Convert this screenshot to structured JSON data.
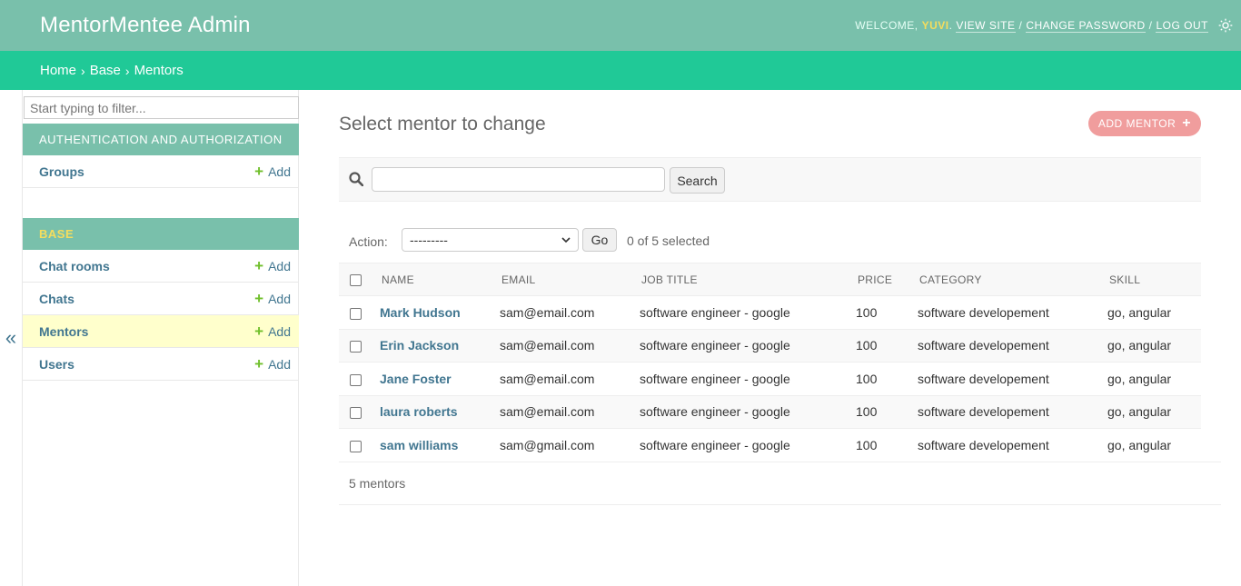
{
  "header": {
    "branding": "MentorMentee Admin",
    "welcome": "WELCOME,",
    "username": "YUVI",
    "view_site": "VIEW SITE",
    "change_password": "CHANGE PASSWORD",
    "log_out": "LOG OUT",
    "separator": "/",
    "theme_icon": "sun-icon"
  },
  "breadcrumbs": {
    "items": [
      "Home",
      "Base",
      "Mentors"
    ],
    "separator": "›"
  },
  "sidebar": {
    "collapse_glyph": "«",
    "filter_placeholder": "Start typing to filter...",
    "add_label": "Add",
    "modules": [
      {
        "caption": "AUTHENTICATION AND AUTHORIZATION",
        "models": [
          {
            "name": "Groups",
            "current": false
          }
        ]
      },
      {
        "caption": "BASE",
        "models": [
          {
            "name": "Chat rooms",
            "current": false
          },
          {
            "name": "Chats",
            "current": false
          },
          {
            "name": "Mentors",
            "current": true
          },
          {
            "name": "Users",
            "current": false
          }
        ]
      }
    ]
  },
  "content": {
    "title": "Select mentor to change",
    "add_button": "ADD MENTOR",
    "search_button": "Search",
    "search_value": "",
    "action_label": "Action:",
    "action_selected": "---------",
    "go_button": "Go",
    "selected_count": "0 of 5 selected",
    "columns": [
      "NAME",
      "EMAIL",
      "JOB TITLE",
      "PRICE",
      "CATEGORY",
      "SKILL"
    ],
    "rows": [
      {
        "name": "Mark Hudson",
        "email": "sam@email.com",
        "job_title": "software engineer - google",
        "price": "100",
        "category": "software developement",
        "skill": "go, angular"
      },
      {
        "name": "Erin Jackson",
        "email": "sam@email.com",
        "job_title": "software engineer - google",
        "price": "100",
        "category": "software developement",
        "skill": "go, angular"
      },
      {
        "name": "Jane Foster",
        "email": "sam@email.com",
        "job_title": "software engineer - google",
        "price": "100",
        "category": "software developement",
        "skill": "go, angular"
      },
      {
        "name": "laura roberts",
        "email": "sam@email.com",
        "job_title": "software engineer - google",
        "price": "100",
        "category": "software developement",
        "skill": "go, angular"
      },
      {
        "name": "sam williams",
        "email": "sam@gmail.com",
        "job_title": "software engineer - google",
        "price": "100",
        "category": "software developement",
        "skill": "go, angular"
      }
    ],
    "paginator": "5 mentors"
  },
  "colors": {
    "header_bg": "#79c0ab",
    "breadcrumb_bg": "#20c997",
    "link": "#417690",
    "add_button_bg": "#f09d9d",
    "current_row_bg": "#ffffcc",
    "username": "#f5dd5d",
    "add_plus": "#70bf2b"
  }
}
